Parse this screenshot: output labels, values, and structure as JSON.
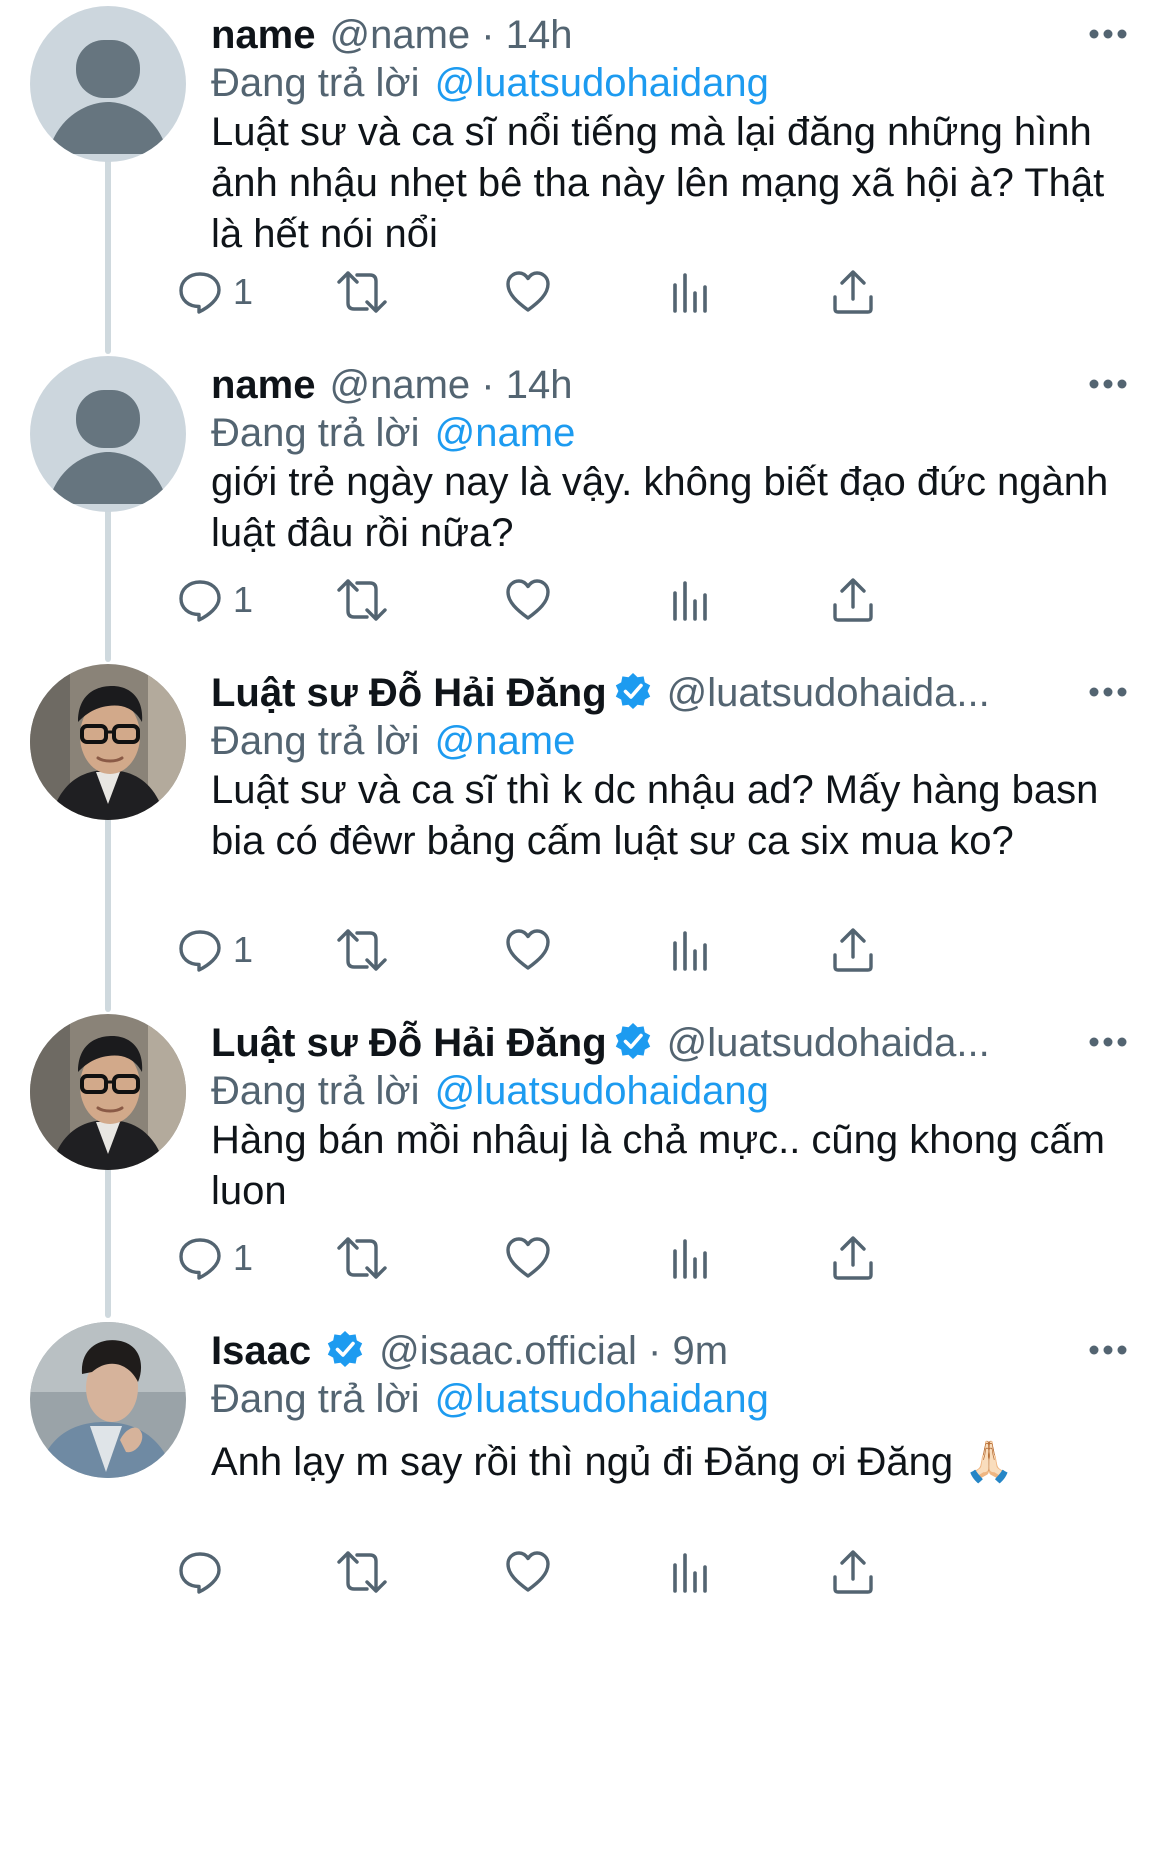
{
  "colors": {
    "accent": "#1d9bf0",
    "text": "#0f1419",
    "secondary": "#536471",
    "thread_line": "#cfd9de",
    "verified": "#1d9bf0"
  },
  "tweets": [
    {
      "display_name": "name",
      "verified": false,
      "handle": "@name",
      "separator": "·",
      "time": "14h",
      "reply_prefix": "Đang trả lời",
      "reply_to": "@luatsudohaidang",
      "text": "Luật sư và ca sĩ nổi tiếng mà lại đăng những hình ảnh nhậu nhẹt bê tha này lên mạng xã hội à? Thật là hết nói nổi",
      "reply_count": "1",
      "avatar": "default-avatar"
    },
    {
      "display_name": "name",
      "verified": false,
      "handle": "@name",
      "separator": "·",
      "time": "14h",
      "reply_prefix": "Đang trả lời",
      "reply_to": "@name",
      "text": "giới trẻ ngày nay là vậy. không biết đạo đức ngành luật đâu rồi nữa?",
      "reply_count": "1",
      "avatar": "default-avatar"
    },
    {
      "display_name": "Luật sư Đỗ Hải Đăng",
      "verified": true,
      "handle": "@luatsudohaida...",
      "reply_prefix": "Đang trả lời",
      "reply_to": "@name",
      "text": "Luật sư và ca sĩ thì k dc nhậu ad? Mấy hàng basn bia có đêwr bảng cấm luật sư ca six mua ko?",
      "reply_count": "1",
      "avatar": "photo-avatar"
    },
    {
      "display_name": "Luật sư Đỗ Hải Đăng",
      "verified": true,
      "handle": "@luatsudohaida...",
      "reply_prefix": "Đang trả lời",
      "reply_to": "@luatsudohaidang",
      "text": "Hàng bán mồi nhâuj là chả mực.. cũng khong cấm luon",
      "reply_count": "1",
      "avatar": "photo-avatar"
    },
    {
      "display_name": "Isaac",
      "verified": true,
      "handle": "@isaac.official",
      "separator": "·",
      "time": "9m",
      "reply_prefix": "Đang trả lời",
      "reply_to": "@luatsudohaidang",
      "text": "Anh lạy m say rồi thì ngủ đi Đăng ơi Đăng 🙏🏻",
      "reply_count": "",
      "avatar": "photo-avatar"
    }
  ],
  "action_icons": [
    "reply-icon",
    "retweet-icon",
    "like-icon",
    "analytics-icon",
    "share-icon"
  ],
  "more_icon": "more-icon"
}
